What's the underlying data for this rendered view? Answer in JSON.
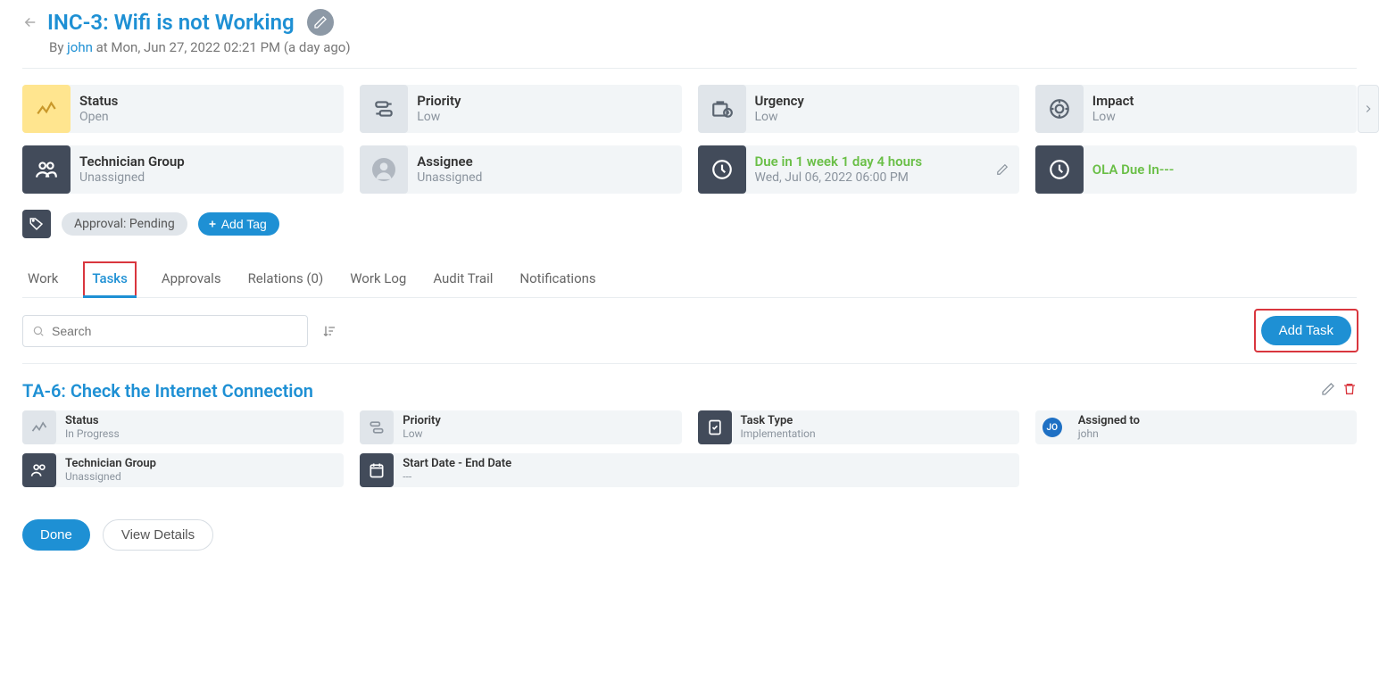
{
  "header": {
    "title": "INC-3: Wifi is not Working",
    "by_prefix": "By ",
    "user": "john",
    "at": " at Mon, Jun 27, 2022 02:21 PM (a day ago)"
  },
  "info_row1": [
    {
      "label": "Status",
      "value": "Open",
      "icon": "status"
    },
    {
      "label": "Priority",
      "value": "Low",
      "icon": "priority"
    },
    {
      "label": "Urgency",
      "value": "Low",
      "icon": "urgency"
    },
    {
      "label": "Impact",
      "value": "Low",
      "icon": "impact"
    }
  ],
  "info_row2": [
    {
      "label": "Technician Group",
      "value": "Unassigned",
      "icon": "group"
    },
    {
      "label": "Assignee",
      "value": "Unassigned",
      "icon": "assignee"
    },
    {
      "label": "Due in 1 week 1 day 4 hours",
      "value": "Wed, Jul 06, 2022 06:00 PM",
      "icon": "due",
      "green_label": true,
      "editable": true
    },
    {
      "label": "OLA Due In---",
      "value": "",
      "icon": "ola",
      "green_label": true
    }
  ],
  "tags": {
    "approval": "Approval: Pending",
    "add_tag": "Add Tag"
  },
  "tabs": [
    {
      "label": "Work",
      "active": false
    },
    {
      "label": "Tasks",
      "active": true,
      "highlight": true
    },
    {
      "label": "Approvals",
      "active": false
    },
    {
      "label": "Relations (0)",
      "active": false
    },
    {
      "label": "Work Log",
      "active": false
    },
    {
      "label": "Audit Trail",
      "active": false
    },
    {
      "label": "Notifications",
      "active": false
    }
  ],
  "toolbar": {
    "search_placeholder": "Search",
    "add_task": "Add Task"
  },
  "task": {
    "title": "TA-6: Check the Internet Connection",
    "cards_row1": [
      {
        "label": "Status",
        "value": "In Progress",
        "icon": "tstatus"
      },
      {
        "label": "Priority",
        "value": "Low",
        "icon": "tpriority"
      },
      {
        "label": "Task Type",
        "value": "Implementation",
        "icon": "ttype"
      },
      {
        "label": "Assigned to",
        "value": "john",
        "icon": "tassign",
        "avatar": "JO"
      }
    ],
    "cards_row2": [
      {
        "label": "Technician Group",
        "value": "Unassigned",
        "icon": "tgroup"
      },
      {
        "label": "Start Date - End Date",
        "value": "---",
        "icon": "tdate"
      }
    ],
    "buttons": {
      "done": "Done",
      "details": "View Details"
    }
  }
}
